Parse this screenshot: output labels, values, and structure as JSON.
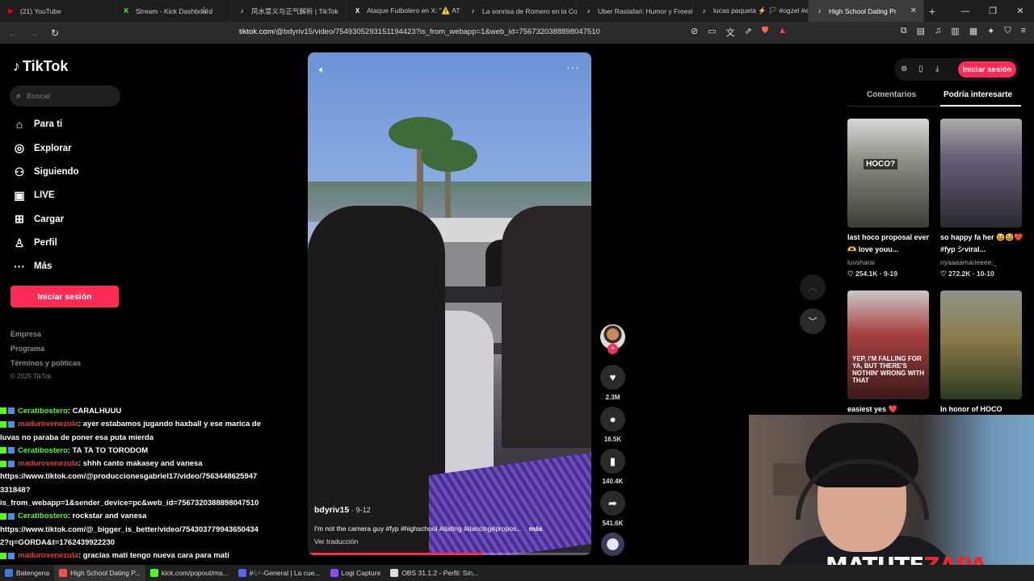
{
  "browser": {
    "tabs": [
      {
        "label": "(21) YouTube",
        "color": "#ff0000",
        "glyph": "▶"
      },
      {
        "label": "Stream - Kick Dashboard",
        "color": "#53fc18",
        "glyph": "K"
      },
      {
        "label": "风水意义与正气解析 | TikTok",
        "color": "#ffffff",
        "glyph": "♪"
      },
      {
        "label": "Ataque Futbolero en X: \"⚠️ AT",
        "color": "#ffffff",
        "glyph": "X"
      },
      {
        "label": "La sonrisa de Romero en la Co",
        "color": "#ffffff",
        "glyph": "♪"
      },
      {
        "label": "Uber Rastafari: Humor y Freest",
        "color": "#ffffff",
        "glyph": "♪"
      },
      {
        "label": "lucas paqueta ⚡️ 🏳 #ogzel #e",
        "color": "#ffffff",
        "glyph": "♪"
      },
      {
        "label": "High School Dating Pr",
        "color": "#ffffff",
        "glyph": "♪"
      }
    ],
    "url_domain": "tiktok.com",
    "url_rest": "/@bdyriv15/video/7549305293151194423?is_from_webapp=1&web_id=7567320388898047510"
  },
  "sidebar": {
    "logo": "TikTok",
    "search_placeholder": "Buscar",
    "nav": [
      {
        "label": "Para ti",
        "icon": "home-icon",
        "glyph": "⌂"
      },
      {
        "label": "Explorar",
        "icon": "compass-icon",
        "glyph": "◎"
      },
      {
        "label": "Siguiendo",
        "icon": "following-icon",
        "glyph": "⚇"
      },
      {
        "label": "LIVE",
        "icon": "live-icon",
        "glyph": "▣"
      },
      {
        "label": "Cargar",
        "icon": "upload-icon",
        "glyph": "⊞"
      },
      {
        "label": "Perfil",
        "icon": "profile-icon",
        "glyph": "♙"
      },
      {
        "label": "Más",
        "icon": "more-icon",
        "glyph": "···"
      }
    ],
    "login_label": "Iniciar sesión",
    "footer": [
      "Empresa",
      "Programa",
      "Términos y políticas"
    ],
    "copyright": "© 2025 TikTok"
  },
  "video": {
    "author": "bdyriv15",
    "date": "9-12",
    "caption": "I'm not the camera guy #fyp #highschool #dating #dancing#propos...",
    "more": "más",
    "translate": "Ver traducción",
    "progress": 0.62
  },
  "actions": {
    "likes": "2.3M",
    "comments": "16.5K",
    "saves": "140.4K",
    "shares": "541.6K"
  },
  "right_panel": {
    "login_label": "Iniciar sesión",
    "tab_comments": "Comentarios",
    "tab_suggested": "Podría interesarte",
    "cards": [
      {
        "title": "last hoco proposal ever🫶 love youu...",
        "author": "luvsharai",
        "likes": "254.1K",
        "date": "9-19",
        "bg": "#6b6a63"
      },
      {
        "title": "so happy fa her 😆😆❤️ #fyp シviral...",
        "author": "nyaaaamarieeee._",
        "likes": "272.2K",
        "date": "10-10",
        "bg": "#5c5670"
      },
      {
        "title": "easiest yes ❤️",
        "author": "",
        "likes": "",
        "date": "",
        "bg": "#8a3a3a"
      },
      {
        "title": "In honor of HOCO",
        "author": "",
        "likes": "",
        "date": "",
        "bg": "#4a5d3a"
      }
    ],
    "card_overlays": [
      "HOCO?",
      "YEP, I'M FALLING FOR YA, BUT THERE'S NOTHIN' WRONG WITH THAT"
    ]
  },
  "chat": [
    {
      "user": "Ceratibostero",
      "ucolor": "green",
      "msg": ": CARALHUUU"
    },
    {
      "user": "madurovenezula",
      "ucolor": "red",
      "msg": ": ayer estabamos jugando haxball y ese marica de"
    },
    {
      "user": "",
      "ucolor": "",
      "msg": "luvas no paraba de poner esa puta mierda"
    },
    {
      "user": "Ceratibostero",
      "ucolor": "green",
      "msg": ": TA TA TO TORODOM"
    },
    {
      "user": "madurovenezula",
      "ucolor": "red",
      "msg": ": shhh canto makasey and vanesa"
    },
    {
      "user": "",
      "ucolor": "",
      "msg": "https://www.tiktok.com/@produccionesgabriel17/video/7563448625947"
    },
    {
      "user": "",
      "ucolor": "",
      "msg": "331848?"
    },
    {
      "user": "",
      "ucolor": "",
      "msg": "is_from_webapp=1&sender_device=pc&web_id=7567320388898047510"
    },
    {
      "user": "Ceratibostero",
      "ucolor": "green",
      "msg": ": rockstar and vanesa"
    },
    {
      "user": "",
      "ucolor": "",
      "msg": "https://www.tiktok.com/@_bigger_is_better/video/754303779943650434"
    },
    {
      "user": "",
      "ucolor": "",
      "msg": "2?q=GORDA&t=1762439922230"
    },
    {
      "user": "madurovenezula",
      "ucolor": "red",
      "msg": ": gracias mati tengo nueva cara para mati"
    }
  ],
  "webcam": {
    "brand_white": "MATUTE",
    "brand_red": "ZAPA"
  },
  "taskbar": [
    {
      "label": "Batengena",
      "color": "#3a7bd5"
    },
    {
      "label": "High School Dating P...",
      "color": "#ff5050",
      "active": true
    },
    {
      "label": "kick.com/popout/ma...",
      "color": "#53fc18"
    },
    {
      "label": "#🎶-General | La cue...",
      "color": "#5865f2"
    },
    {
      "label": "Logi Capture",
      "color": "#8a4bff"
    },
    {
      "label": "OBS 31.1.2 - Perfil: Sin...",
      "color": "#ddd"
    }
  ]
}
